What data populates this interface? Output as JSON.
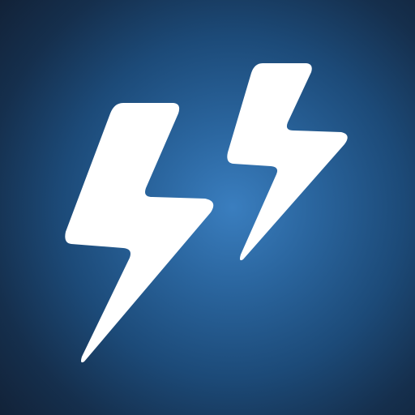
{
  "icon": {
    "name": "double-lightning-bolt-icon",
    "colors": {
      "background_center": "#3a7ebf",
      "background_edge": "#122238",
      "bolt": "#ffffff"
    }
  }
}
